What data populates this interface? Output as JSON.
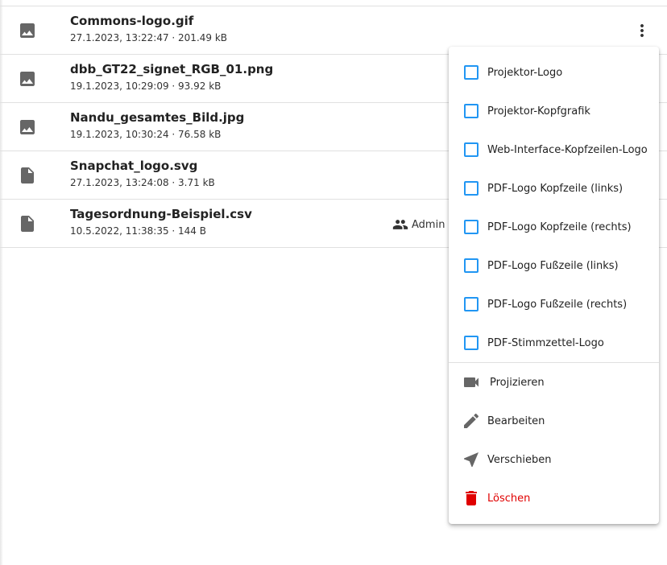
{
  "files": [
    {
      "name": "Commons-logo.gif",
      "meta": "27.1.2023, 13:22:47 · 201.49 kB",
      "icon": "image-icon"
    },
    {
      "name": "dbb_GT22_signet_RGB_01.png",
      "meta": "19.1.2023, 10:29:09 · 93.92 kB",
      "icon": "image-icon"
    },
    {
      "name": "Nandu_gesamtes_Bild.jpg",
      "meta": "19.1.2023, 10:30:24 · 76.58 kB",
      "icon": "image-icon"
    },
    {
      "name": "Snapchat_logo.svg",
      "meta": "27.1.2023, 13:24:08 · 3.71 kB",
      "icon": "file-icon"
    },
    {
      "name": "Tagesordnung-Beispiel.csv",
      "meta": "10.5.2022, 11:38:35 · 144 B",
      "icon": "file-icon",
      "owner": "Admin"
    }
  ],
  "menu": {
    "checkboxes": [
      {
        "label": "Projektor-Logo",
        "checked": false
      },
      {
        "label": "Projektor-Kopfgrafik",
        "checked": false
      },
      {
        "label": "Web-Interface-Kopfzeilen-Logo",
        "checked": false
      },
      {
        "label": "PDF-Logo Kopfzeile (links)",
        "checked": false
      },
      {
        "label": "PDF-Logo Kopfzeile (rechts)",
        "checked": false
      },
      {
        "label": "PDF-Logo Fußzeile (links)",
        "checked": false
      },
      {
        "label": "PDF-Logo Fußzeile (rechts)",
        "checked": false
      },
      {
        "label": "PDF-Stimmzettel-Logo",
        "checked": false
      }
    ],
    "actions": [
      {
        "label": "Projizieren",
        "icon": "videocam-icon"
      },
      {
        "label": "Bearbeiten",
        "icon": "pencil-icon"
      },
      {
        "label": "Verschieben",
        "icon": "navigation-arrow-icon"
      },
      {
        "label": "Löschen",
        "icon": "trash-icon"
      }
    ]
  },
  "colors": {
    "checkbox_border": "#2196f3",
    "delete": "#e00000",
    "icon_gray": "#666666"
  }
}
